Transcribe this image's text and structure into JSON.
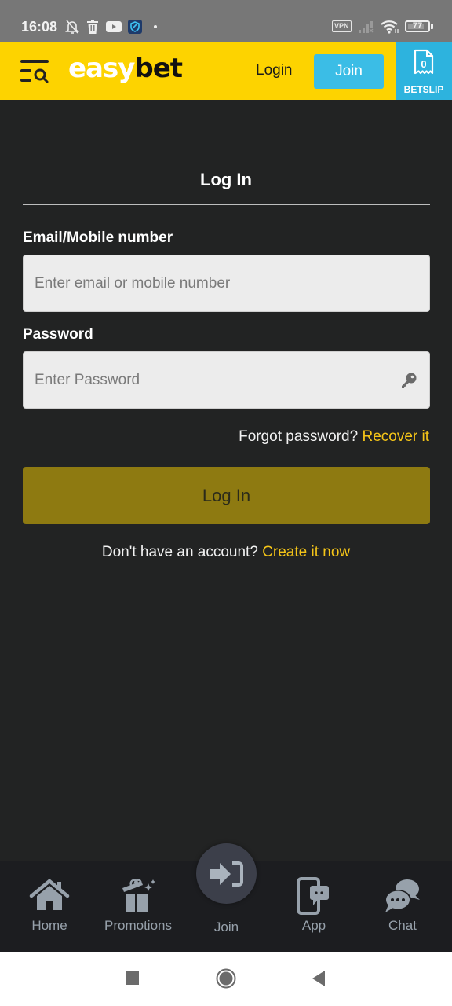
{
  "status_bar": {
    "time": "16:08",
    "vpn_label": "VPN",
    "battery_level": "77",
    "icons": [
      "bell-off-icon",
      "trash-icon",
      "youtube-icon",
      "shield-app-icon",
      "dot-icon",
      "vpn-icon",
      "signal-icon",
      "wifi-icon",
      "battery-icon"
    ]
  },
  "header": {
    "logo_part1": "easy",
    "logo_part2": "bet",
    "login_label": "Login",
    "join_label": "Join",
    "betslip_count": "0",
    "betslip_label": "BETSLIP",
    "colors": {
      "brand_yellow": "#fdd300",
      "accent_blue": "#3bbde6"
    }
  },
  "form": {
    "title": "Log In",
    "email_label": "Email/Mobile number",
    "email_placeholder": "Enter email or mobile number",
    "email_value": "",
    "password_label": "Password",
    "password_placeholder": "Enter Password",
    "password_value": "",
    "forgot_text": "Forgot password?",
    "recover_link": "Recover it",
    "submit_label": "Log In",
    "signup_text": "Don't have an account?",
    "signup_link": "Create it now",
    "colors": {
      "link": "#f5c518",
      "submit_bg": "#8e7a11"
    }
  },
  "bottom_nav": {
    "items": [
      {
        "label": "Home",
        "icon": "home-icon"
      },
      {
        "label": "Promotions",
        "icon": "gift-icon"
      },
      {
        "label": "Join",
        "icon": "sign-in-icon"
      },
      {
        "label": "App",
        "icon": "mobile-chat-icon"
      },
      {
        "label": "Chat",
        "icon": "chat-bubbles-icon"
      }
    ]
  },
  "system_nav": {
    "buttons": [
      "recents",
      "home",
      "back"
    ]
  }
}
